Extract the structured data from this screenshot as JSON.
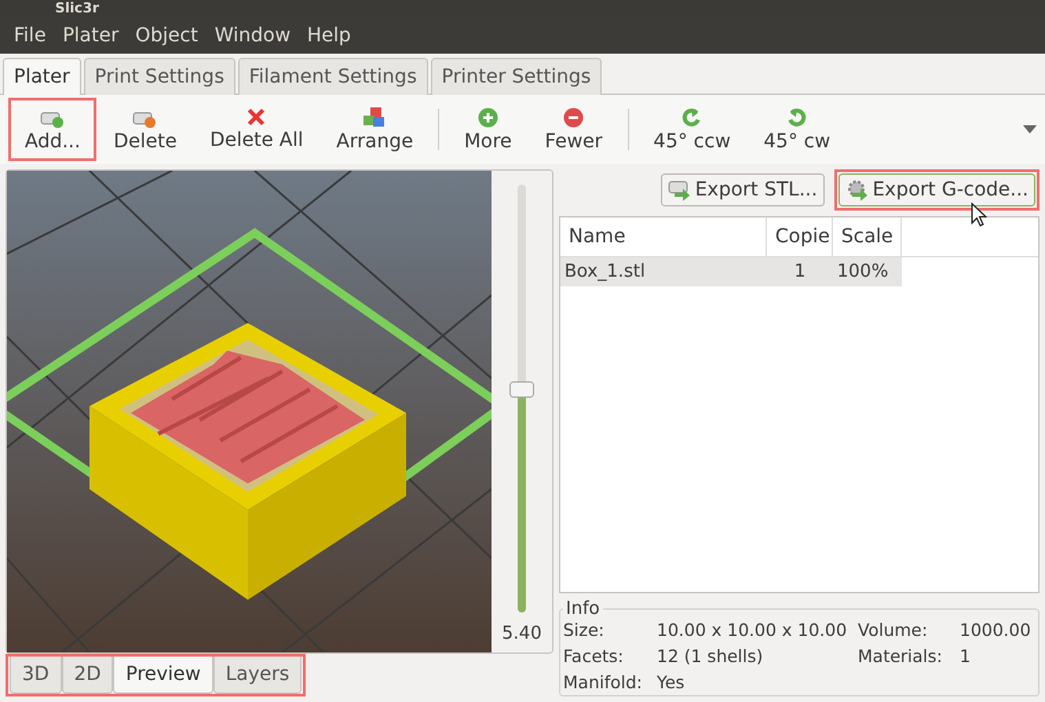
{
  "window": {
    "title": "Slic3r"
  },
  "menu": [
    "File",
    "Plater",
    "Object",
    "Window",
    "Help"
  ],
  "tabs": [
    {
      "label": "Plater",
      "selected": true
    },
    {
      "label": "Print Settings",
      "selected": false
    },
    {
      "label": "Filament Settings",
      "selected": false
    },
    {
      "label": "Printer Settings",
      "selected": false
    }
  ],
  "toolbar": [
    {
      "label": "Add...",
      "kind": "add",
      "highlighted": true
    },
    {
      "label": "Delete",
      "kind": "delete",
      "highlighted": false
    },
    {
      "label": "Delete All",
      "kind": "deleteall",
      "highlighted": false
    },
    {
      "label": "Arrange",
      "kind": "arrange",
      "highlighted": false
    },
    {
      "label": "More",
      "kind": "more",
      "highlighted": false,
      "separator_before": true
    },
    {
      "label": "Fewer",
      "kind": "fewer",
      "highlighted": false
    },
    {
      "label": "45° ccw",
      "kind": "ccw",
      "highlighted": false,
      "separator_before": true
    },
    {
      "label": "45° cw",
      "kind": "cw",
      "highlighted": false
    }
  ],
  "layer_slider": {
    "level": 0.52,
    "reading": "5.40"
  },
  "view_tabs": {
    "highlighted": true,
    "items": [
      {
        "label": "3D",
        "selected": false
      },
      {
        "label": "2D",
        "selected": false
      },
      {
        "label": "Preview",
        "selected": true
      },
      {
        "label": "Layers",
        "selected": false
      }
    ]
  },
  "export_buttons": [
    {
      "label": "Export STL...",
      "kind": "stl",
      "highlighted": false
    },
    {
      "label": "Export G-code...",
      "kind": "gcode",
      "highlighted": true
    }
  ],
  "table": {
    "columns": [
      "Name",
      "Copie",
      "Scale"
    ],
    "rows": [
      {
        "cells": [
          "Box_1.stl",
          "1",
          "100%"
        ],
        "selected": true
      }
    ]
  },
  "info": {
    "title": "Info",
    "fields": [
      [
        "Size:",
        "10.00 x 10.00 x 10.00",
        "Volume:",
        "1000.00"
      ],
      [
        "Facets:",
        "12 (1 shells)",
        "Materials:",
        "1"
      ],
      [
        "Manifold:",
        "Yes"
      ]
    ]
  }
}
